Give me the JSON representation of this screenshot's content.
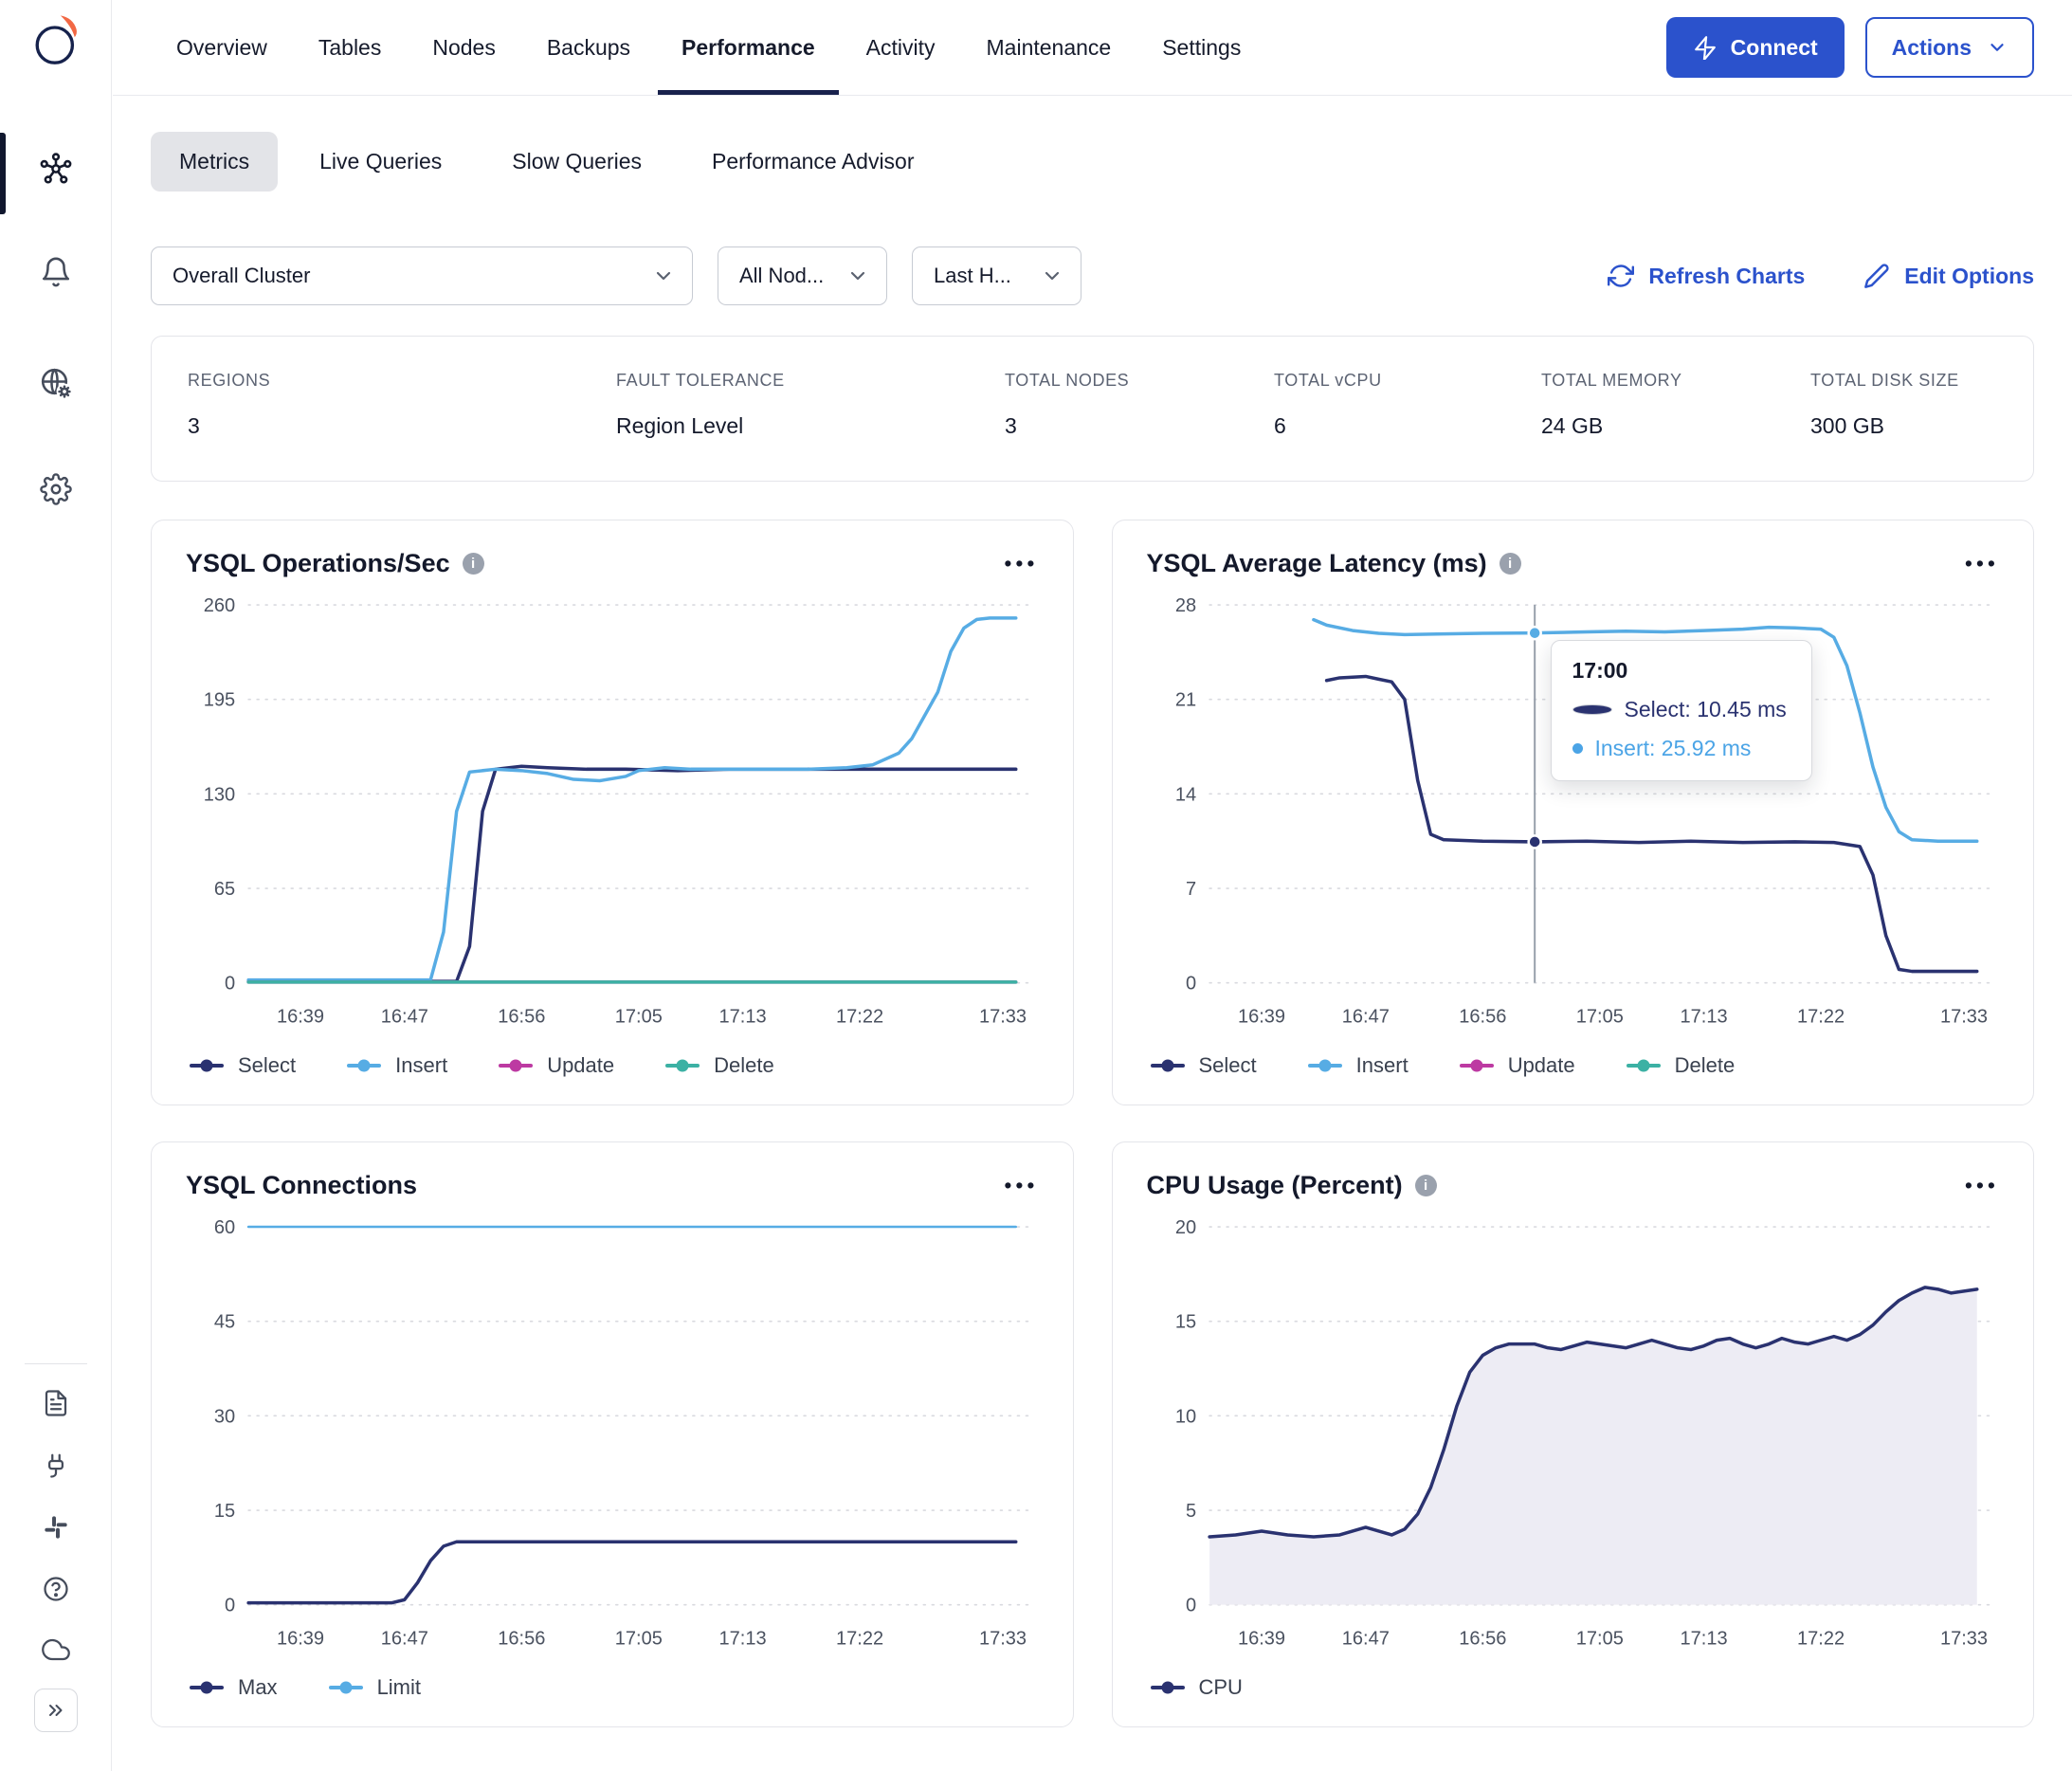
{
  "nav": {
    "tabs": [
      "Overview",
      "Tables",
      "Nodes",
      "Backups",
      "Performance",
      "Activity",
      "Maintenance",
      "Settings"
    ],
    "active_tab": "Performance",
    "connect_label": "Connect",
    "actions_label": "Actions"
  },
  "subtabs": {
    "items": [
      "Metrics",
      "Live Queries",
      "Slow Queries",
      "Performance Advisor"
    ],
    "active": "Metrics"
  },
  "filters": {
    "cluster_selected": "Overall Cluster",
    "nodes_selected": "All Nod...",
    "range_selected": "Last H...",
    "refresh_label": "Refresh Charts",
    "edit_label": "Edit Options"
  },
  "stats": [
    {
      "label": "REGIONS",
      "value": "3"
    },
    {
      "label": "FAULT TOLERANCE",
      "value": "Region Level"
    },
    {
      "label": "TOTAL NODES",
      "value": "3"
    },
    {
      "label": "TOTAL vCPU",
      "value": "6"
    },
    {
      "label": "TOTAL MEMORY",
      "value": "24 GB"
    },
    {
      "label": "TOTAL DISK SIZE",
      "value": "300 GB"
    }
  ],
  "sidebar": {
    "icons": [
      "yugabyte-logo",
      "clusters-network-icon",
      "alerts-bell-icon",
      "network-access-globe-gear-icon",
      "settings-gear-icon",
      "docs-file-icon",
      "integrations-plug-icon",
      "slack-icon",
      "help-circle-icon",
      "cloud-status-icon",
      "expand-sidebar-chevrons-icon"
    ]
  },
  "colors": {
    "accent_blue": "#2b52cc",
    "select_navy": "#2a3270",
    "insert_blue": "#57ace4",
    "update_magenta": "#bd3aa2",
    "delete_teal": "#3cb1a4",
    "cpu_area_fill": "#edecf4",
    "active_tab_underline": "#19224d"
  },
  "charts": {
    "ysql_ops": {
      "title": "YSQL Operations/Sec",
      "type": "line",
      "ylim": [
        0,
        260
      ],
      "yticks": [
        0,
        65,
        130,
        195,
        260
      ],
      "xdomain": [
        "16:35",
        "17:35"
      ],
      "xticks": [
        "16:39",
        "16:47",
        "16:56",
        "17:05",
        "17:13",
        "17:22",
        "17:33"
      ],
      "series": [
        {
          "name": "Select",
          "color": "#2a3270",
          "points": [
            [
              "16:35",
              1
            ],
            [
              "16:51",
              1
            ],
            [
              "16:52",
              25
            ],
            [
              "16:53",
              118
            ],
            [
              "16:54",
              147
            ],
            [
              "16:56",
              149
            ],
            [
              "16:58",
              148
            ],
            [
              "17:01",
              147
            ],
            [
              "17:04",
              147
            ],
            [
              "17:08",
              146
            ],
            [
              "17:12",
              147
            ],
            [
              "17:16",
              147
            ],
            [
              "17:20",
              147
            ],
            [
              "17:24",
              147
            ],
            [
              "17:28",
              147
            ],
            [
              "17:34",
              147
            ]
          ]
        },
        {
          "name": "Insert",
          "color": "#57ace4",
          "points": [
            [
              "16:35",
              2
            ],
            [
              "16:49",
              2
            ],
            [
              "16:50",
              35
            ],
            [
              "16:51",
              118
            ],
            [
              "16:52",
              145
            ],
            [
              "16:54",
              147
            ],
            [
              "16:56",
              146
            ],
            [
              "16:58",
              144
            ],
            [
              "17:00",
              140
            ],
            [
              "17:02",
              139
            ],
            [
              "17:04",
              142
            ],
            [
              "17:05",
              146
            ],
            [
              "17:07",
              148
            ],
            [
              "17:09",
              147
            ],
            [
              "17:12",
              147
            ],
            [
              "17:15",
              147
            ],
            [
              "17:18",
              147
            ],
            [
              "17:21",
              148
            ],
            [
              "17:23",
              150
            ],
            [
              "17:25",
              158
            ],
            [
              "17:26",
              168
            ],
            [
              "17:28",
              200
            ],
            [
              "17:29",
              228
            ],
            [
              "17:30",
              244
            ],
            [
              "17:31",
              250
            ],
            [
              "17:32",
              251
            ],
            [
              "17:34",
              251
            ]
          ]
        },
        {
          "name": "Update",
          "color": "#bd3aa2",
          "points": [
            [
              "16:35",
              0.5
            ],
            [
              "17:34",
              0.5
            ]
          ]
        },
        {
          "name": "Delete",
          "color": "#3cb1a4",
          "points": [
            [
              "16:35",
              0.5
            ],
            [
              "17:34",
              0.5
            ]
          ]
        }
      ]
    },
    "ysql_latency": {
      "title": "YSQL Average Latency (ms)",
      "type": "line",
      "ylim": [
        0,
        28
      ],
      "yticks": [
        0,
        7,
        14,
        21,
        28
      ],
      "xdomain": [
        "16:35",
        "17:35"
      ],
      "xticks": [
        "16:39",
        "16:47",
        "16:56",
        "17:05",
        "17:13",
        "17:22",
        "17:33"
      ],
      "series": [
        {
          "name": "Select",
          "color": "#2a3270",
          "points": [
            [
              "16:44",
              22.4
            ],
            [
              "16:45",
              22.6
            ],
            [
              "16:47",
              22.7
            ],
            [
              "16:48",
              22.5
            ],
            [
              "16:49",
              22.3
            ],
            [
              "16:50",
              21
            ],
            [
              "16:51",
              15
            ],
            [
              "16:52",
              11
            ],
            [
              "16:53",
              10.6
            ],
            [
              "16:56",
              10.5
            ],
            [
              "17:00",
              10.45
            ],
            [
              "17:04",
              10.5
            ],
            [
              "17:08",
              10.4
            ],
            [
              "17:12",
              10.5
            ],
            [
              "17:16",
              10.4
            ],
            [
              "17:20",
              10.45
            ],
            [
              "17:23",
              10.4
            ],
            [
              "17:25",
              10.1
            ],
            [
              "17:26",
              8
            ],
            [
              "17:27",
              3.5
            ],
            [
              "17:28",
              1
            ],
            [
              "17:29",
              0.85
            ],
            [
              "17:34",
              0.85
            ]
          ]
        },
        {
          "name": "Insert",
          "color": "#57ace4",
          "points": [
            [
              "16:43",
              26.9
            ],
            [
              "16:44",
              26.5
            ],
            [
              "16:46",
              26.1
            ],
            [
              "16:48",
              25.9
            ],
            [
              "16:50",
              25.8
            ],
            [
              "16:53",
              25.85
            ],
            [
              "16:56",
              25.9
            ],
            [
              "17:00",
              25.92
            ],
            [
              "17:04",
              26.0
            ],
            [
              "17:07",
              26.05
            ],
            [
              "17:10",
              26.0
            ],
            [
              "17:13",
              26.1
            ],
            [
              "17:16",
              26.2
            ],
            [
              "17:18",
              26.35
            ],
            [
              "17:20",
              26.3
            ],
            [
              "17:22",
              26.2
            ],
            [
              "17:23",
              25.6
            ],
            [
              "17:24",
              23.5
            ],
            [
              "17:25",
              20
            ],
            [
              "17:26",
              16
            ],
            [
              "17:27",
              13
            ],
            [
              "17:28",
              11.2
            ],
            [
              "17:29",
              10.6
            ],
            [
              "17:31",
              10.5
            ],
            [
              "17:34",
              10.5
            ]
          ]
        },
        {
          "name": "Update",
          "color": "#bd3aa2",
          "points": []
        },
        {
          "name": "Delete",
          "color": "#3cb1a4",
          "points": []
        }
      ],
      "marker": {
        "time": "17:00",
        "points": [
          {
            "series": "Insert",
            "value": 25.92
          },
          {
            "series": "Select",
            "value": 10.45
          }
        ]
      },
      "tooltip": {
        "title": "17:00",
        "select_row": "Select: 10.45 ms",
        "insert_row": "Insert: 25.92 ms"
      }
    },
    "ysql_connections": {
      "title": "YSQL Connections",
      "type": "line",
      "ylim": [
        0,
        60
      ],
      "yticks": [
        0,
        15,
        30,
        45,
        60
      ],
      "xdomain": [
        "16:35",
        "17:35"
      ],
      "xticks": [
        "16:39",
        "16:47",
        "16:56",
        "17:05",
        "17:13",
        "17:22",
        "17:33"
      ],
      "series": [
        {
          "name": "Max",
          "color": "#2a3270",
          "points": [
            [
              "16:35",
              0.3
            ],
            [
              "16:46",
              0.3
            ],
            [
              "16:47",
              0.8
            ],
            [
              "16:48",
              3.5
            ],
            [
              "16:49",
              7
            ],
            [
              "16:50",
              9.3
            ],
            [
              "16:51",
              10
            ],
            [
              "17:34",
              10
            ]
          ]
        },
        {
          "name": "Limit",
          "color": "#57ace4",
          "width": 2.5,
          "points": [
            [
              "16:35",
              60
            ],
            [
              "17:34",
              60
            ]
          ]
        }
      ]
    },
    "cpu_usage": {
      "title": "CPU Usage (Percent)",
      "type": "area",
      "ylim": [
        0,
        20
      ],
      "yticks": [
        0,
        5,
        10,
        15,
        20
      ],
      "xdomain": [
        "16:35",
        "17:35"
      ],
      "xticks": [
        "16:39",
        "16:47",
        "16:56",
        "17:05",
        "17:13",
        "17:22",
        "17:33"
      ],
      "series": [
        {
          "name": "CPU",
          "color": "#2a3270",
          "area": true,
          "fill": "#edecf4",
          "points": [
            [
              "16:35",
              3.6
            ],
            [
              "16:37",
              3.7
            ],
            [
              "16:39",
              3.9
            ],
            [
              "16:40",
              3.8
            ],
            [
              "16:41",
              3.7
            ],
            [
              "16:43",
              3.6
            ],
            [
              "16:45",
              3.7
            ],
            [
              "16:46",
              3.9
            ],
            [
              "16:47",
              4.1
            ],
            [
              "16:48",
              3.9
            ],
            [
              "16:49",
              3.7
            ],
            [
              "16:50",
              4.0
            ],
            [
              "16:51",
              4.8
            ],
            [
              "16:52",
              6.2
            ],
            [
              "16:53",
              8.2
            ],
            [
              "16:54",
              10.5
            ],
            [
              "16:55",
              12.3
            ],
            [
              "16:56",
              13.2
            ],
            [
              "16:57",
              13.6
            ],
            [
              "16:58",
              13.8
            ],
            [
              "17:00",
              13.8
            ],
            [
              "17:01",
              13.6
            ],
            [
              "17:02",
              13.5
            ],
            [
              "17:03",
              13.7
            ],
            [
              "17:04",
              13.9
            ],
            [
              "17:05",
              13.8
            ],
            [
              "17:07",
              13.6
            ],
            [
              "17:08",
              13.8
            ],
            [
              "17:09",
              14.0
            ],
            [
              "17:10",
              13.8
            ],
            [
              "17:11",
              13.6
            ],
            [
              "17:12",
              13.5
            ],
            [
              "17:13",
              13.7
            ],
            [
              "17:14",
              14.0
            ],
            [
              "17:15",
              14.1
            ],
            [
              "17:16",
              13.8
            ],
            [
              "17:17",
              13.6
            ],
            [
              "17:18",
              13.8
            ],
            [
              "17:19",
              14.1
            ],
            [
              "17:20",
              13.9
            ],
            [
              "17:21",
              13.8
            ],
            [
              "17:22",
              14.0
            ],
            [
              "17:23",
              14.2
            ],
            [
              "17:24",
              14.0
            ],
            [
              "17:25",
              14.3
            ],
            [
              "17:26",
              14.8
            ],
            [
              "17:27",
              15.5
            ],
            [
              "17:28",
              16.1
            ],
            [
              "17:29",
              16.5
            ],
            [
              "17:30",
              16.8
            ],
            [
              "17:31",
              16.7
            ],
            [
              "17:32",
              16.5
            ],
            [
              "17:33",
              16.6
            ],
            [
              "17:34",
              16.7
            ]
          ]
        }
      ]
    }
  }
}
